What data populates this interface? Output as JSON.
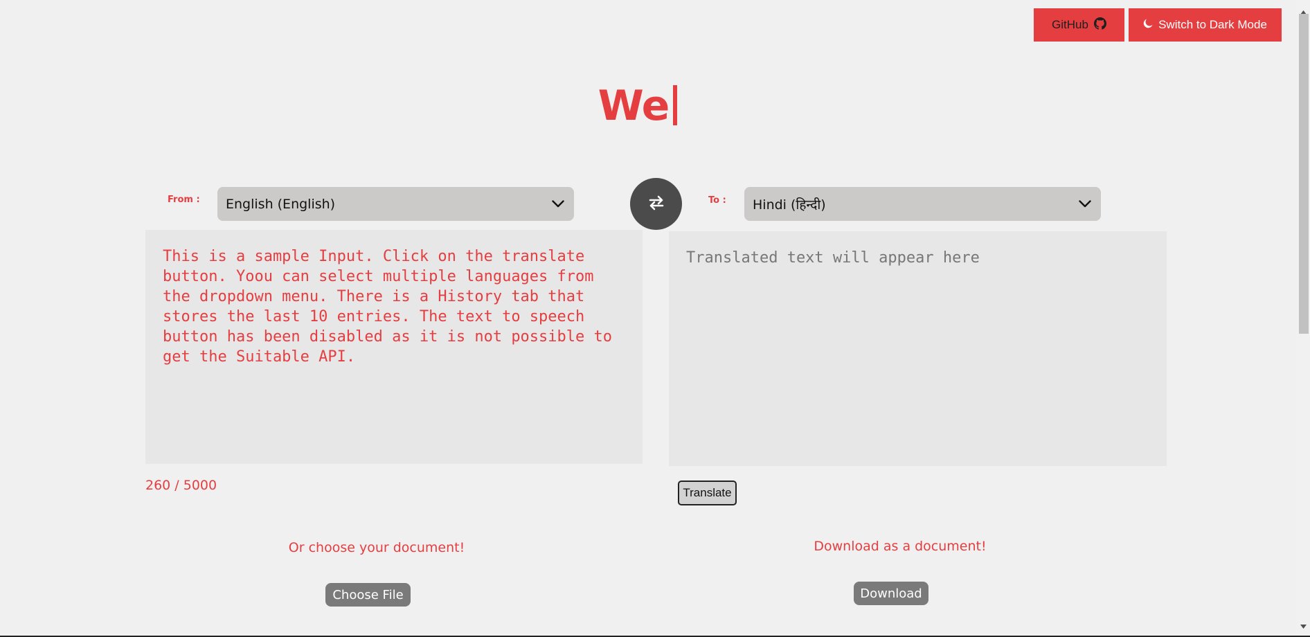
{
  "header": {
    "github_label": "GitHub",
    "dark_mode_label": "Switch to Dark Mode",
    "github_icon": "github-icon",
    "moon_icon": "moon-icon"
  },
  "title": "We",
  "from": {
    "label": "From :",
    "selected": "English (English)"
  },
  "to": {
    "label": "To :",
    "selected": "Hindi (हिन्दी)"
  },
  "swap_icon": "swap-arrows-icon",
  "input": {
    "text": "This is a sample Input. Click on the translate button. Yoou can select multiple languages from the dropdown menu. There is a History tab that stores the last 10 entries. The text to speech button has been disabled as it is not possible to get the Suitable API.",
    "char_count": "260 / 5000"
  },
  "output": {
    "placeholder": "Translated text will appear here"
  },
  "translate_label": "Translate",
  "upload": {
    "hint": "Or choose your document!",
    "button_label": "Choose File"
  },
  "download": {
    "hint": "Download as a document!",
    "button_label": "Download"
  },
  "colors": {
    "accent": "#e53e41",
    "background": "#f0f0f0",
    "select_bg": "#cbcac9",
    "textarea_bg": "#e7e7e7",
    "swap_bg": "#4b4b4b",
    "pill_button_bg": "#7a7a7a"
  }
}
